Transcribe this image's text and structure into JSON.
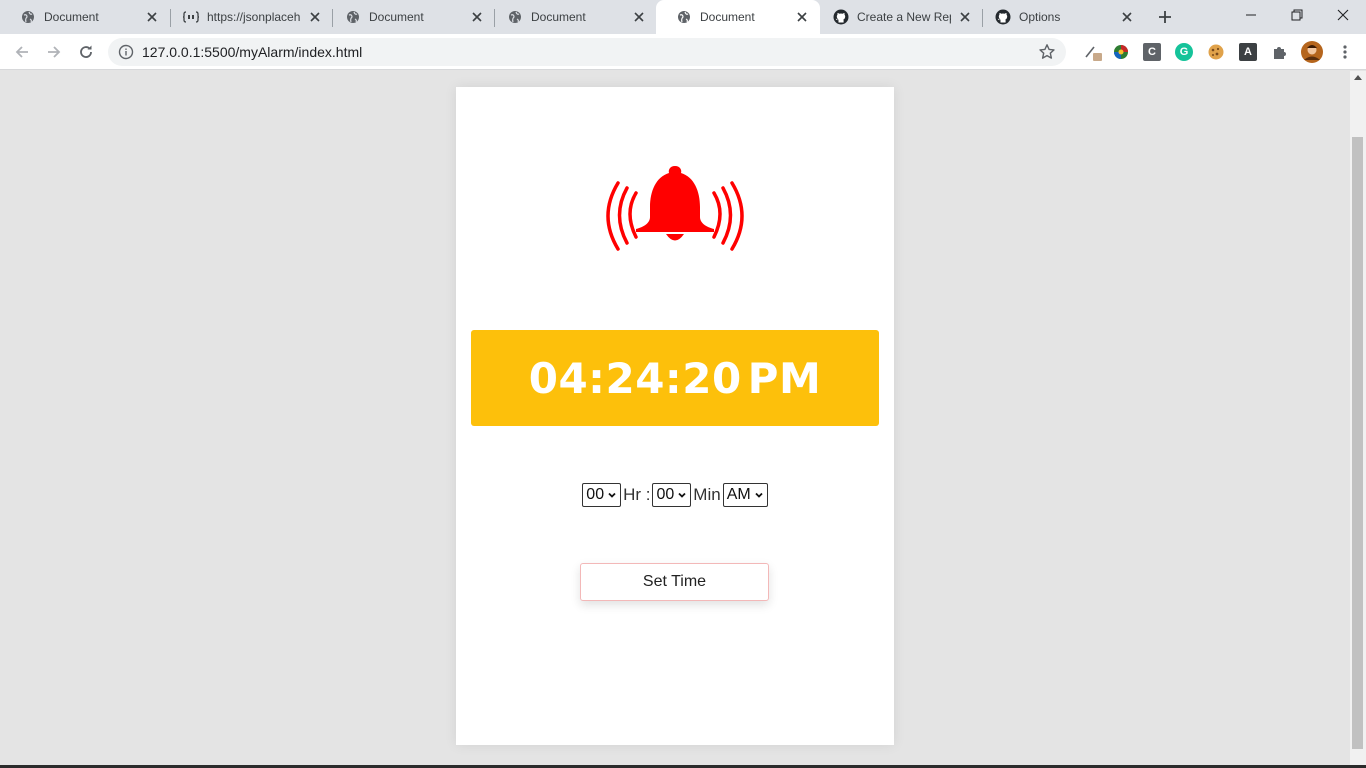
{
  "browser": {
    "tabs": [
      {
        "title": "Document",
        "favicon": "globe-icon",
        "active": false
      },
      {
        "title": "https://jsonplaceh",
        "favicon": "json-placeholder-icon",
        "active": false
      },
      {
        "title": "Document",
        "favicon": "globe-icon",
        "active": false
      },
      {
        "title": "Document",
        "favicon": "globe-icon",
        "active": false
      },
      {
        "title": "Document",
        "favicon": "globe-icon",
        "active": true
      },
      {
        "title": "Create a New Rep",
        "favicon": "github-icon",
        "active": false
      },
      {
        "title": "Options",
        "favicon": "github-icon",
        "active": false
      }
    ],
    "url": "127.0.0.1:5500/myAlarm/index.html",
    "extensions": [
      "extension-pin-icon",
      "colorful-extension-icon",
      "c-extension-icon",
      "grammarly-icon",
      "cookie-icon",
      "a-extension-icon",
      "puzzle-icon",
      "profile-avatar"
    ],
    "ext_letters": {
      "c": "C",
      "grammarly": "G",
      "a": "A"
    }
  },
  "alarm": {
    "clock_time": "04:24:20",
    "clock_ampm": "PM",
    "hour_value": "00",
    "hour_label": "Hr :",
    "minute_value": "00",
    "minute_label": "Min",
    "ampm_value": "AM",
    "set_button_label": "Set Time"
  },
  "colors": {
    "bell": "#ff0000",
    "clock_bg": "#fdc00b",
    "page_bg": "#e4e4e4",
    "card_bg": "#ffffff"
  }
}
